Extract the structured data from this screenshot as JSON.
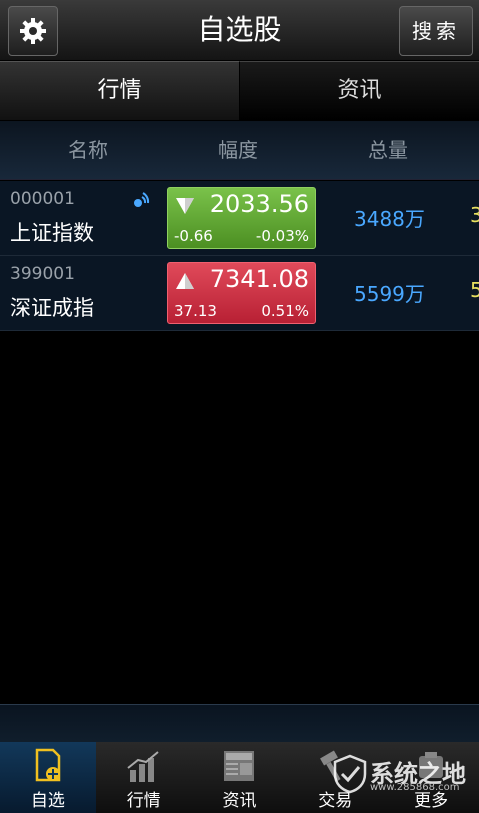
{
  "header": {
    "title": "自选股",
    "search_label": "搜索"
  },
  "tabs": [
    {
      "label": "行情"
    },
    {
      "label": "资讯"
    }
  ],
  "columns": {
    "name": "名称",
    "range": "幅度",
    "volume": "总量"
  },
  "rows": [
    {
      "code": "000001",
      "name": "上证指数",
      "price": "2033.56",
      "change": "-0.66",
      "percent": "-0.03%",
      "volume": "3488万",
      "cut": "3",
      "direction": "down"
    },
    {
      "code": "399001",
      "name": "深证成指",
      "price": "7341.08",
      "change": "37.13",
      "percent": "0.51%",
      "volume": "5599万",
      "cut": "5",
      "direction": "up"
    }
  ],
  "bottom_nav": [
    {
      "label": "自选"
    },
    {
      "label": "行情"
    },
    {
      "label": "资讯"
    },
    {
      "label": "交易"
    },
    {
      "label": "更多"
    }
  ],
  "watermark": {
    "text": "系统之地",
    "url": "www.285868.com"
  },
  "colors": {
    "up": "#c82a3c",
    "down": "#5ea532",
    "volume": "#4aa8ff"
  }
}
